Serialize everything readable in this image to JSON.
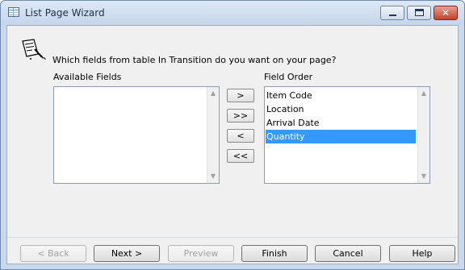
{
  "window": {
    "title": "List Page Wizard",
    "controls": {
      "minimize": "minimize",
      "maximize": "maximize",
      "close": "✕"
    }
  },
  "wizard": {
    "question": "Which fields from table In Transition do you want on your page?",
    "available_label": "Available Fields",
    "field_order_label": "Field Order",
    "available_fields": [],
    "field_order": [
      "Item Code",
      "Location",
      "Arrival Date",
      "Quantity"
    ],
    "selected_field": "Quantity",
    "move_buttons": {
      "add": ">",
      "add_all": ">>",
      "remove": "<",
      "remove_all": "<<"
    }
  },
  "buttons": {
    "back": "< Back",
    "next": "Next >",
    "preview": "Preview",
    "finish": "Finish",
    "cancel": "Cancel",
    "help": "Help"
  },
  "colors": {
    "selection": "#3399ff",
    "frame": "#c9d9ec",
    "client": "#f0f0f0"
  }
}
